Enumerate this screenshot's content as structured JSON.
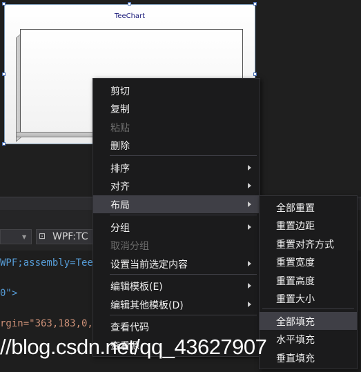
{
  "chart": {
    "title": "TeeChart"
  },
  "editor": {
    "type_selector": "WPF:TC",
    "code_lines": [
      "WPF;assembly=Tee",
      "0\">",
      "rgin=\"363,183,0,"
    ]
  },
  "context_menu": {
    "items": [
      {
        "label": "剪切",
        "enabled": true
      },
      {
        "label": "复制",
        "enabled": true
      },
      {
        "label": "粘贴",
        "enabled": false
      },
      {
        "label": "删除",
        "enabled": true
      },
      {
        "label": "排序",
        "enabled": true,
        "submenu": true
      },
      {
        "label": "对齐",
        "enabled": true,
        "submenu": true
      },
      {
        "label": "布局",
        "enabled": true,
        "submenu": true,
        "highlighted": true
      },
      {
        "label": "分组",
        "enabled": true,
        "submenu": true
      },
      {
        "label": "取消分组",
        "enabled": false
      },
      {
        "label": "设置当前选定内容",
        "enabled": true,
        "submenu": true
      },
      {
        "label": "编辑模板(E)",
        "enabled": true,
        "submenu": true
      },
      {
        "label": "编辑其他模板(D)",
        "enabled": true,
        "submenu": true
      },
      {
        "label": "查看代码",
        "enabled": true
      },
      {
        "label": "查看源",
        "enabled": true
      }
    ]
  },
  "layout_submenu": {
    "items": [
      {
        "label": "全部重置"
      },
      {
        "label": "重置边距"
      },
      {
        "label": "重置对齐方式"
      },
      {
        "label": "重置宽度"
      },
      {
        "label": "重置高度"
      },
      {
        "label": "重置大小"
      },
      {
        "label": "全部填充",
        "highlighted": true
      },
      {
        "label": "水平填充"
      },
      {
        "label": "垂直填充"
      }
    ]
  },
  "watermark": "//blog.csdn.net/qq_43627907"
}
